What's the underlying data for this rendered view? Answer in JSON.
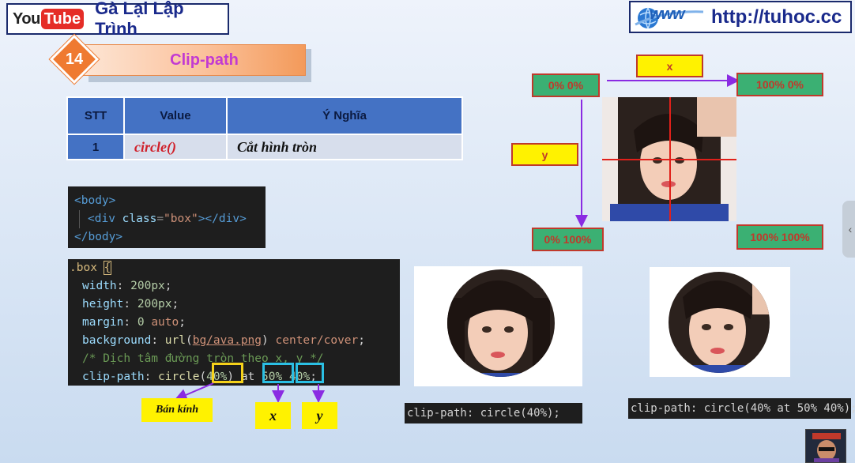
{
  "header": {
    "yt_you": "You",
    "yt_tube": "Tube",
    "channel": "Gà Lại Lập Trình",
    "www": "www",
    "url": "http://tuhoc.cc"
  },
  "badge": {
    "number": "14",
    "title": "Clip-path"
  },
  "table": {
    "headers": [
      "STT",
      "Value",
      "Ý Nghĩa"
    ],
    "rows": [
      {
        "stt": "1",
        "value": "circle()",
        "meaning": "Cắt hình tròn"
      }
    ]
  },
  "html_code": {
    "body_open": "<body>",
    "div_open": "<div",
    "attr": "class",
    "eq": "=",
    "str": "\"box\"",
    "div_close": "></div>",
    "body_close": "</body>"
  },
  "css_code": {
    "selector": ".box",
    "brace_open": "{",
    "width_prop": "width",
    "width_val": "200px",
    "height_prop": "height",
    "height_val": "200px",
    "margin_prop": "margin",
    "margin_num": "0",
    "margin_kw": "auto",
    "bg_prop": "background",
    "bg_fn": "url",
    "bg_path": "bg/ava.png",
    "bg_rest": "center/cover",
    "comment": "/* Dịch tâm đường tròn theo x, y */",
    "clip_prop": "clip-path",
    "clip_fn": "circle",
    "clip_r": "40%",
    "clip_at": "at",
    "clip_x": "50%",
    "clip_y": "40%"
  },
  "annotations": {
    "radius": "Bán kính",
    "x": "x",
    "y": "y"
  },
  "captions": {
    "left": "clip-path: circle(40%);",
    "right": "clip-path: circle(40% at 50% 40%);"
  },
  "diagram": {
    "top_left": "0% 0%",
    "top_right": "100% 0%",
    "bottom_left": "0% 100%",
    "bottom_right": "100% 100%",
    "x_label": "x",
    "y_label": "y"
  },
  "colors": {
    "accent_orange": "#ef7a31",
    "table_header": "#4472c4",
    "diagram_green": "#3bb073",
    "label_yellow": "#fff200"
  },
  "icons": {
    "side_tab": "chevron-left-icon"
  }
}
